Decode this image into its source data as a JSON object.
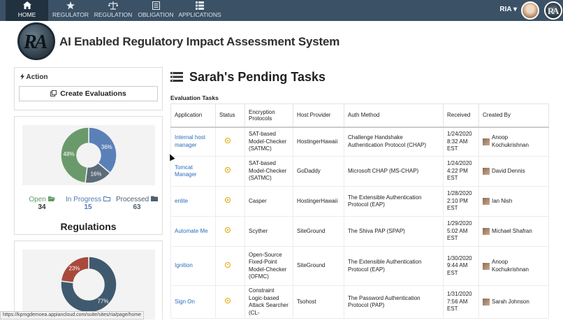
{
  "nav": {
    "items": [
      {
        "label": "HOME",
        "icon": "home-icon",
        "active": true
      },
      {
        "label": "REGULATOR",
        "icon": "star-icon",
        "active": false
      },
      {
        "label": "REGULATION",
        "icon": "scales-icon",
        "active": false
      },
      {
        "label": "OBLIGATION",
        "icon": "list-icon",
        "active": false
      },
      {
        "label": "APPLICATIONS",
        "icon": "grid-icon",
        "active": false
      }
    ],
    "user_menu": "RIA ▾"
  },
  "header": {
    "logo_text": "RA",
    "title": "AI Enabled Regulatory Impact Assessment System"
  },
  "action_panel": {
    "title": "Action",
    "create_button": "Create Evaluations"
  },
  "evaluations_chart": {
    "chart_data": {
      "type": "pie",
      "slices": [
        {
          "label": "Open",
          "value": 48,
          "color": "#6a9a6b"
        },
        {
          "label": "In Progress",
          "value": 36,
          "color": "#5b80b8"
        },
        {
          "label": "Processed",
          "value": 16,
          "color": "#5b6b78"
        }
      ],
      "slice_labels": [
        "48%",
        "36%",
        "16%"
      ]
    },
    "legend": [
      {
        "label": "Open",
        "count": "34",
        "color": "#5f9a63"
      },
      {
        "label": "In Progress",
        "count": "15",
        "color": "#4f79b3"
      },
      {
        "label": "Processed",
        "count": "63",
        "color": "#4d5f6e"
      }
    ],
    "section_title": "Regulations"
  },
  "regulations_chart": {
    "chart_data": {
      "type": "pie",
      "slices": [
        {
          "label": "",
          "value": 77,
          "color": "#3f5a6e"
        },
        {
          "label": "",
          "value": 23,
          "color": "#a8493c"
        }
      ],
      "slice_labels": [
        "77%",
        "23%"
      ]
    }
  },
  "main": {
    "title": "Sarah's Pending Tasks",
    "section_label": "Evaluation Tasks",
    "columns": [
      "Application",
      "Status",
      "Encryption Protocols",
      "Host Provider",
      "Auth Method",
      "Received",
      "Created By"
    ],
    "rows": [
      {
        "application": "Internal host manager",
        "encryption": "SAT-based Model-Checker (SATMC)",
        "host": "HostingerHawaii",
        "auth": "Challenge Handshake Authentication Protocol (CHAP)",
        "received": "1/24/2020 8:32 AM EST",
        "created_by": "Anoop Kochukrishnan"
      },
      {
        "application": "Tomcat Manager",
        "encryption": "SAT-based Model-Checker (SATMC)",
        "host": "GoDaddy",
        "auth": "Microsoft CHAP (MS-CHAP)",
        "received": "1/24/2020 4:22 PM EST",
        "created_by": "David Dennis"
      },
      {
        "application": "enlite",
        "encryption": "Casper",
        "host": "HostingerHawaii",
        "auth": "The Extensible Authentication Protocol (EAP)",
        "received": "1/28/2020 2:10 PM EST",
        "created_by": "Ian Nish"
      },
      {
        "application": "Automate Me",
        "encryption": "Scyther",
        "host": "SiteGround",
        "auth": "The Shiva PAP (SPAP)",
        "received": "1/29/2020 5:02 AM EST",
        "created_by": "Michael Shafran"
      },
      {
        "application": "Ignition",
        "encryption": "Open-Source Fixed-Point Model-Checker (OFMC)",
        "host": "SiteGround",
        "auth": "The Extensible Authentication Protocol (EAP)",
        "received": "1/30/2020 9:44 AM EST",
        "created_by": "Anoop Kochukrishnan"
      },
      {
        "application": "Sign On",
        "encryption": "Constraint Logic-based Attack Searcher (CL-",
        "host": "Tsohost",
        "auth": "The Password Authentication Protocol (PAP)",
        "received": "1/31/2020 7:56 AM EST",
        "created_by": "Sarah Johnson"
      }
    ]
  },
  "statusbar": {
    "url": "https://kpmgdemoea.appiancloud.com/suite/sites/ria/page/home"
  }
}
